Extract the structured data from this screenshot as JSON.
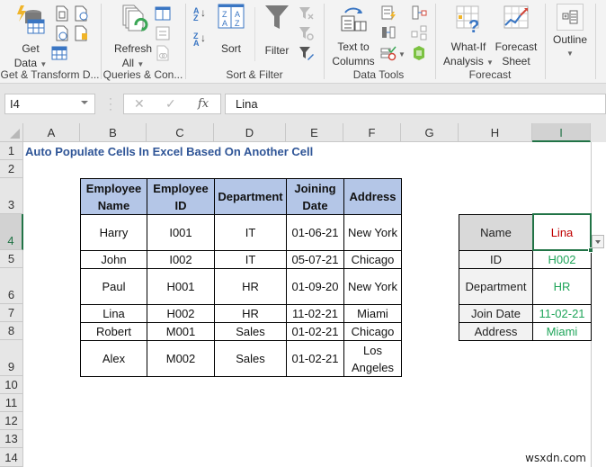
{
  "ribbon": {
    "groups": [
      {
        "label": "Get & Transform D...",
        "buttons": [
          {
            "label_line1": "Get",
            "label_line2": "Data",
            "icon": "database-lightning-icon"
          }
        ]
      },
      {
        "label": "Queries & Con...",
        "buttons": [
          {
            "label_line1": "Refresh",
            "label_line2": "All",
            "icon": "refresh-all-icon"
          }
        ]
      },
      {
        "label": "Sort & Filter",
        "buttons": [
          {
            "label": "Sort",
            "icon": "sort-dialog-icon"
          },
          {
            "label": "Filter",
            "icon": "funnel-icon"
          }
        ],
        "sort_az": "A↓Z",
        "sort_za": "Z↓A"
      },
      {
        "label": "Data Tools",
        "buttons": [
          {
            "label_line1": "Text to",
            "label_line2": "Columns",
            "icon": "text-to-columns-icon"
          }
        ]
      },
      {
        "label": "Forecast",
        "buttons": [
          {
            "label_line1": "What-If",
            "label_line2": "Analysis",
            "icon": "what-if-icon"
          },
          {
            "label_line1": "Forecast",
            "label_line2": "Sheet",
            "icon": "forecast-sheet-icon"
          }
        ]
      },
      {
        "label": "",
        "buttons": [
          {
            "label": "Outline",
            "icon": "outline-icon"
          }
        ]
      }
    ]
  },
  "formula_bar": {
    "name_box": "I4",
    "cancel": "✕",
    "enter": "✓",
    "fx": "fx",
    "value": "Lina"
  },
  "columns": [
    "A",
    "B",
    "C",
    "D",
    "E",
    "F",
    "G",
    "H",
    "I"
  ],
  "rows": [
    "1",
    "2",
    "3",
    "4",
    "5",
    "6",
    "7",
    "8",
    "9",
    "10",
    "11",
    "12",
    "13",
    "14"
  ],
  "selected_cell": "I4",
  "title": "Auto Populate Cells In Excel Based On Another Cell",
  "employee_table": {
    "headers": [
      [
        "Employee",
        "Name"
      ],
      [
        "Employee",
        "ID"
      ],
      [
        "Department"
      ],
      [
        "Joining",
        "Date"
      ],
      [
        "Address"
      ]
    ],
    "rows": [
      [
        "Harry",
        "I001",
        "IT",
        "01-06-21",
        "New York"
      ],
      [
        "John",
        "I002",
        "IT",
        "05-07-21",
        "Chicago"
      ],
      [
        "Paul",
        "H001",
        "HR",
        "01-09-20",
        "New York"
      ],
      [
        "Lina",
        "H002",
        "HR",
        "11-02-21",
        "Miami"
      ],
      [
        "Robert",
        "M001",
        "Sales",
        "01-02-21",
        "Chicago"
      ],
      [
        "Alex",
        "M002",
        "Sales",
        "01-02-21",
        "Los Angeles"
      ]
    ]
  },
  "lookup_table": {
    "rows": [
      {
        "label": "Name",
        "value": "Lina"
      },
      {
        "label": "ID",
        "value": "H002"
      },
      {
        "label": "Department",
        "value": "HR"
      },
      {
        "label": "Join Date",
        "value": "11-02-21"
      },
      {
        "label": "Address",
        "value": "Miami"
      }
    ],
    "colors": {
      "input": "#c00000",
      "output": "#1fa55a"
    }
  },
  "watermark": "wsxdn.com"
}
